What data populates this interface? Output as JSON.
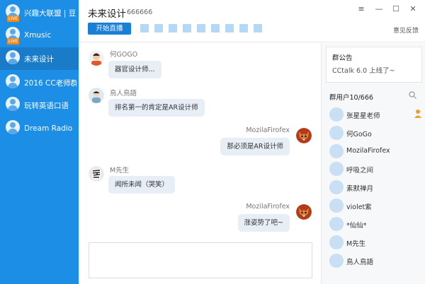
{
  "colors": {
    "sidebar": "#1c8ee6",
    "sidebar_active": "#1a7cc9",
    "accent": "#1a7fd6",
    "bubble": "#e7eef6",
    "live_badge": "#f08a1f",
    "owner_badge": "#f0a030"
  },
  "sidebar": {
    "items": [
      {
        "label": "兴趣大联盟 | 豆...",
        "live": "LIVE"
      },
      {
        "label": "Xmusic",
        "live": "LIVE"
      },
      {
        "label": "未来设计",
        "active": true
      },
      {
        "label": "2016 CC老师群"
      },
      {
        "label": "玩转英语口语"
      },
      {
        "label": "Dream Radio"
      }
    ]
  },
  "header": {
    "title": "未来设计",
    "room_id": "666666",
    "live_button": "开始直播",
    "feedback": "意见反馈",
    "window_controls": {
      "menu": "≡",
      "minimize": "—",
      "maximize": "☐",
      "close": "✕"
    }
  },
  "chat": {
    "messages": [
      {
        "side": "left",
        "name": "何GOGO",
        "text": "器官设计师..."
      },
      {
        "side": "left",
        "name": "鳥人鳥語",
        "text": "排名第一的肯定是AR设计师"
      },
      {
        "side": "right",
        "name": "MozilaFirofex",
        "text": "那必须是AR设计师"
      },
      {
        "side": "left",
        "name": "M先生",
        "text": "闻所未闻（哭笑）"
      },
      {
        "side": "right",
        "name": "MozilaFirofex",
        "text": "涨姿势了吧~"
      }
    ]
  },
  "panel": {
    "notice_title": "群公告",
    "notice_text": "CCtalk 6.0 上线了~",
    "members_title": "群用户10/666",
    "members": [
      {
        "name": "张星星老师",
        "owner": true
      },
      {
        "name": "何GoGo"
      },
      {
        "name": "MozilaFirofex"
      },
      {
        "name": "呼吸之间"
      },
      {
        "name": "素默禅月"
      },
      {
        "name": "violet紫"
      },
      {
        "name": "*仙仙*"
      },
      {
        "name": "M先生"
      },
      {
        "name": "鳥人鳥語"
      }
    ]
  }
}
